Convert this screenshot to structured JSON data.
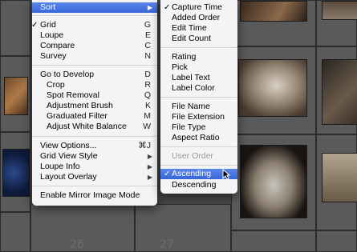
{
  "grid": {
    "numbers": [
      "26",
      "27"
    ]
  },
  "main_menu": {
    "items": [
      {
        "label": "Sort",
        "arrow": "▶",
        "highlight": true
      },
      {
        "label": "Grid",
        "check": "✓",
        "shortcut": "G"
      },
      {
        "label": "Loupe",
        "shortcut": "E"
      },
      {
        "label": "Compare",
        "shortcut": "C"
      },
      {
        "label": "Survey",
        "shortcut": "N"
      },
      {
        "label": "Go to Develop",
        "shortcut": "D"
      },
      {
        "label": "Crop",
        "shortcut": "R"
      },
      {
        "label": "Spot Removal",
        "shortcut": "Q"
      },
      {
        "label": "Adjustment Brush",
        "shortcut": "K"
      },
      {
        "label": "Graduated Filter",
        "shortcut": "M"
      },
      {
        "label": "Adjust White Balance",
        "shortcut": "W"
      },
      {
        "label": "View Options...",
        "shortcut": "⌘J"
      },
      {
        "label": "Grid View Style",
        "arrow": "▶"
      },
      {
        "label": "Loupe Info",
        "arrow": "▶"
      },
      {
        "label": "Layout Overlay",
        "arrow": "▶"
      },
      {
        "label": "Enable Mirror Image Mode"
      }
    ]
  },
  "sort_menu": {
    "items": [
      {
        "label": "Capture Time",
        "check": "✓"
      },
      {
        "label": "Added Order"
      },
      {
        "label": "Edit Time"
      },
      {
        "label": "Edit Count"
      },
      {
        "label": "Rating"
      },
      {
        "label": "Pick"
      },
      {
        "label": "Label Text"
      },
      {
        "label": "Label Color"
      },
      {
        "label": "File Name"
      },
      {
        "label": "File Extension"
      },
      {
        "label": "File Type"
      },
      {
        "label": "Aspect Ratio"
      },
      {
        "label": "User Order",
        "disabled": true
      },
      {
        "label": "Ascending",
        "check": "✓",
        "highlight": true
      },
      {
        "label": "Descending"
      }
    ]
  },
  "colors": {
    "highlight": "#3a68db",
    "menu_bg": "#fafafc",
    "grid_bg": "#474747"
  }
}
